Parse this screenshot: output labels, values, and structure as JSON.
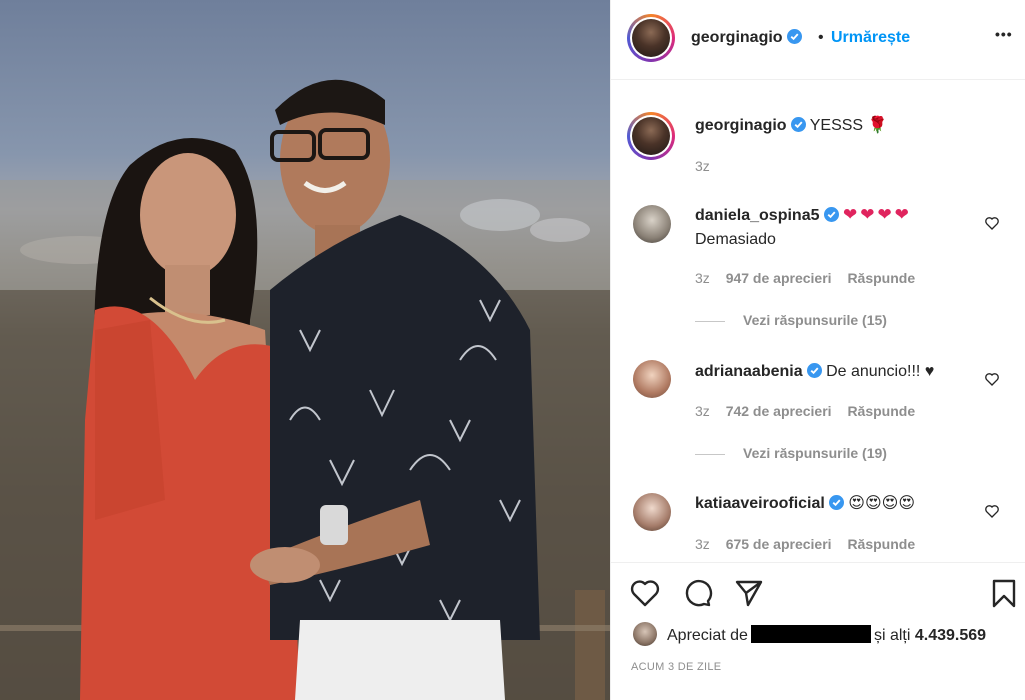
{
  "post": {
    "author": "georginagio",
    "follow_label": "Urmărește",
    "separator": "•",
    "more_label": "•••"
  },
  "caption": {
    "author": "georginagio",
    "text": "YESSS",
    "emoji": "🌹",
    "time": "3z"
  },
  "comments": [
    {
      "author": "daniela_ospina5",
      "text_line1": "❤❤❤❤",
      "text_line2": "Demasiado",
      "time": "3z",
      "likes": "947 de aprecieri",
      "reply": "Răspunde",
      "view_replies": "Vezi răspunsurile (15)"
    },
    {
      "author": "adrianaabenia",
      "text_line1": "De anuncio!!! ♥",
      "time": "3z",
      "likes": "742 de aprecieri",
      "reply": "Răspunde",
      "view_replies": "Vezi răspunsurile (19)"
    },
    {
      "author": "katiaaveirooficial",
      "text_line1": "😍😍😍😍",
      "time": "3z",
      "likes": "675 de aprecieri",
      "reply": "Răspunde"
    }
  ],
  "footer": {
    "liked_prefix": "Apreciat de",
    "liked_suffix": "și alți",
    "liked_count": "4.439.569",
    "timestamp": "ACUM 3 DE ZILE"
  },
  "colors": {
    "accent": "#0095f6",
    "verified": "#3897f0",
    "muted": "#8e8e8e",
    "heart": "#e0245e"
  },
  "icons": [
    "verified-badge-icon",
    "more-options-icon",
    "heart-icon",
    "comment-icon",
    "share-icon",
    "bookmark-icon"
  ]
}
